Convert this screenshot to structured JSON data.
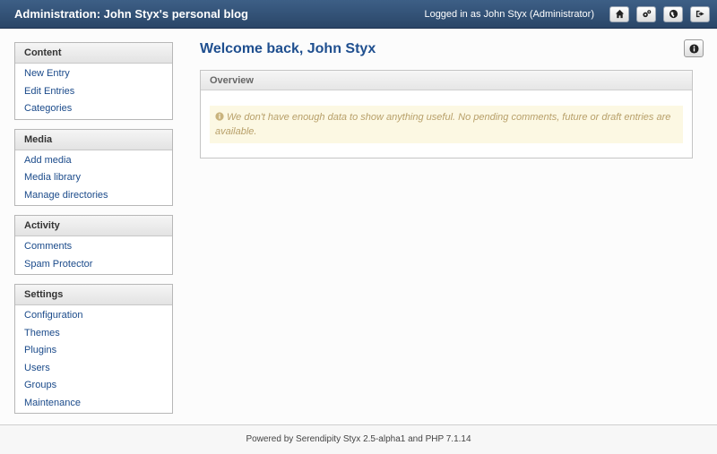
{
  "header": {
    "title": "Administration: John Styx's personal blog",
    "logged_in": "Logged in as John Styx (Administrator)",
    "buttons": [
      {
        "icon": "home-icon"
      },
      {
        "icon": "gears-icon"
      },
      {
        "icon": "globe-icon"
      },
      {
        "icon": "logout-icon"
      }
    ]
  },
  "sidebar": {
    "sections": [
      {
        "title": "Content",
        "items": [
          "New Entry",
          "Edit Entries",
          "Categories"
        ]
      },
      {
        "title": "Media",
        "items": [
          "Add media",
          "Media library",
          "Manage directories"
        ]
      },
      {
        "title": "Activity",
        "items": [
          "Comments",
          "Spam Protector"
        ]
      },
      {
        "title": "Settings",
        "items": [
          "Configuration",
          "Themes",
          "Plugins",
          "Users",
          "Groups",
          "Maintenance"
        ]
      }
    ]
  },
  "main": {
    "welcome": "Welcome back, John Styx",
    "overview_title": "Overview",
    "notice": "We don't have enough data to show anything useful. No pending comments, future or draft entries are available."
  },
  "footer": {
    "text": "Powered by Serendipity Styx 2.5-alpha1 and PHP 7.1.14"
  },
  "colors": {
    "header_bg": "#2f4f74",
    "link": "#1a4a8a",
    "heading": "#1f4f8f",
    "notice_bg": "#fcf8e3",
    "notice_text": "#b8a06a"
  }
}
